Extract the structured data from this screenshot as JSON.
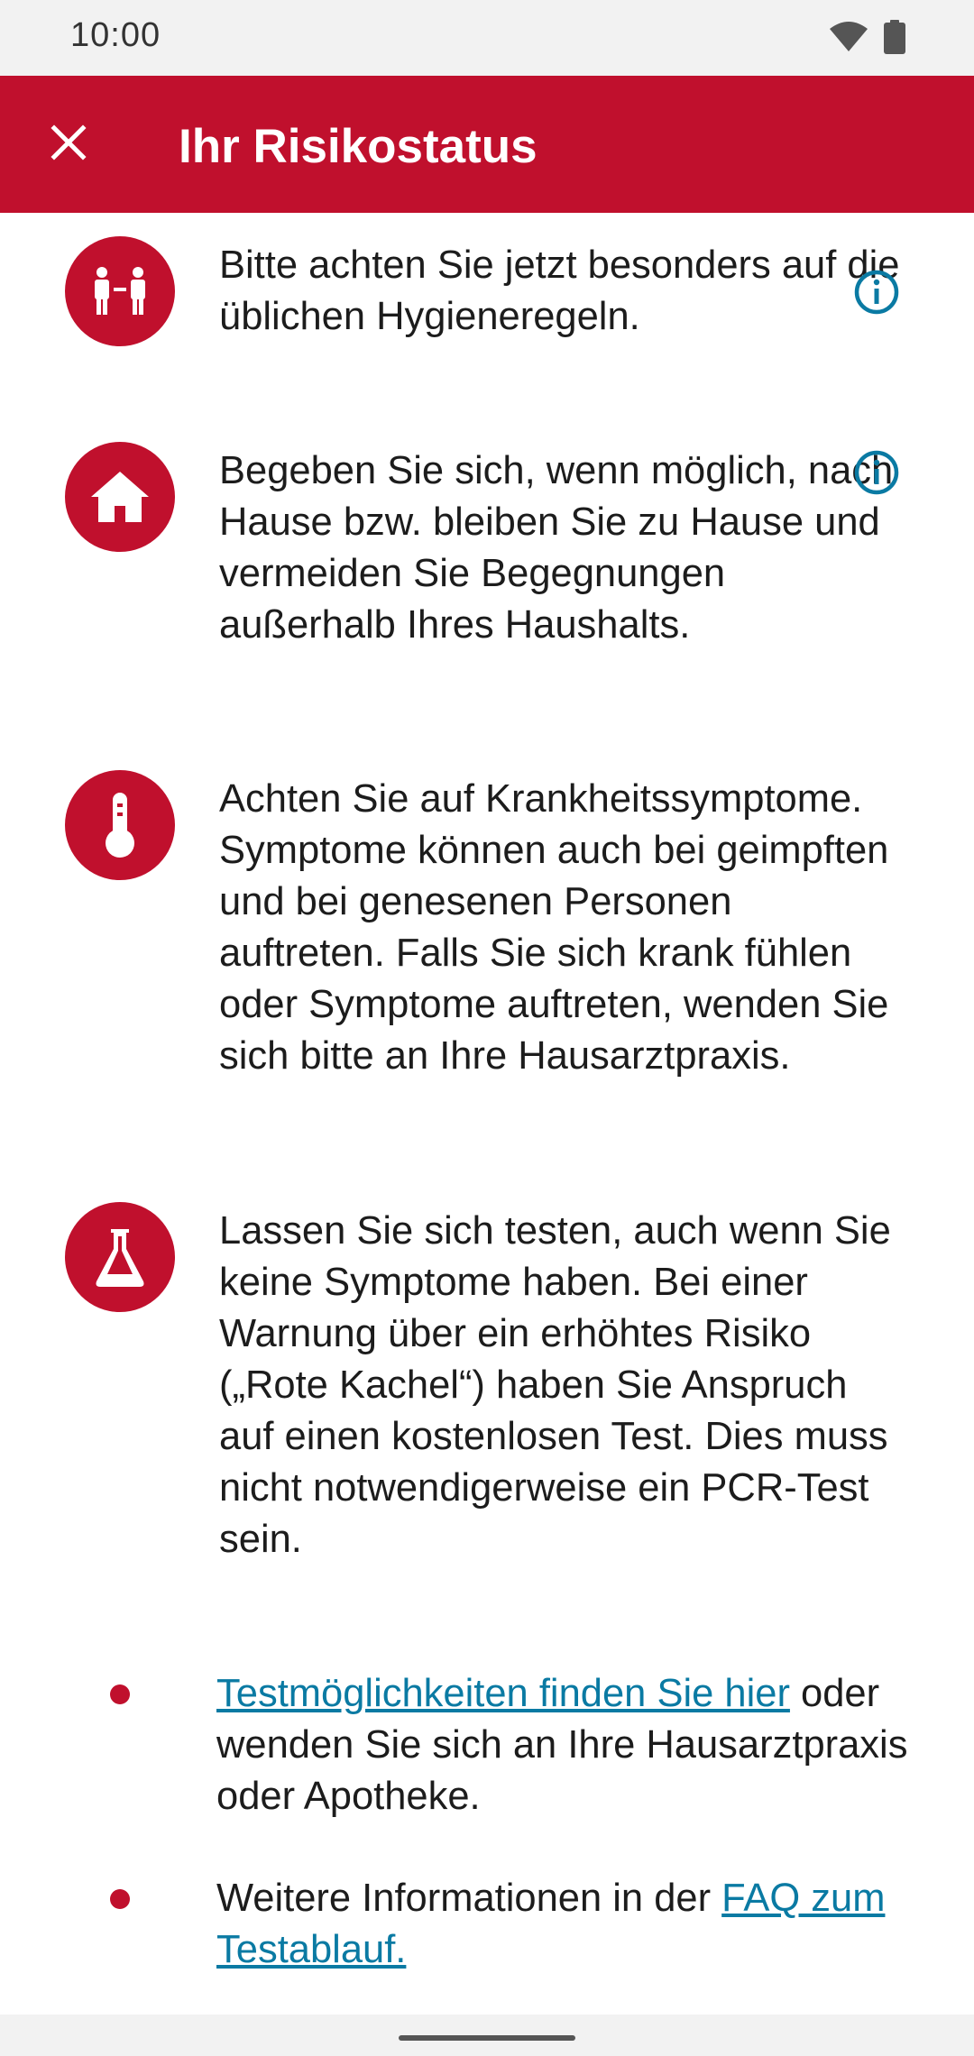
{
  "status_bar": {
    "time": "10:00",
    "icons": [
      "wifi-icon",
      "battery-icon"
    ]
  },
  "app_bar": {
    "title": "Ihr Risikostatus",
    "close_icon": "close-icon",
    "background_color": "#c0102d"
  },
  "items": [
    {
      "icon": "distance-people-icon",
      "text": "Bitte achten Sie jetzt besonders auf die üblichen Hygieneregeln.",
      "has_info": true
    },
    {
      "icon": "home-icon",
      "text": "Begeben Sie sich, wenn möglich, nach Hause bzw. bleiben Sie zu Hause und vermeiden Sie Begegnungen außerhalb Ihres Haushalts.",
      "has_info": true
    },
    {
      "icon": "thermometer-icon",
      "text": "Achten Sie auf Krankheitssymptome. Symptome können auch bei geimpften und bei genesenen Personen auftreten. Falls Sie sich krank fühlen oder Symptome auftreten, wenden Sie sich bitte an Ihre Hausarztpraxis.",
      "has_info": false
    },
    {
      "icon": "test-flask-icon",
      "text": "Lassen Sie sich testen, auch wenn Sie keine Symptome haben. Bei einer Warnung über ein erhöhtes Risiko („Rote Kachel“) haben Sie Anspruch auf einen kostenlosen Test. Dies muss nicht notwendigerweise ein PCR-Test sein.",
      "has_info": false
    }
  ],
  "bullets": [
    {
      "before": "",
      "link": "Testmöglichkeiten finden Sie hier",
      "after": " oder wenden Sie sich an Ihre Hausarztpraxis oder Apotheke."
    },
    {
      "before": "Weitere Informationen in der ",
      "link": "FAQ zum Testablauf.",
      "after": ""
    }
  ],
  "colors": {
    "accent": "#c0102d",
    "link": "#0a7aa3"
  }
}
